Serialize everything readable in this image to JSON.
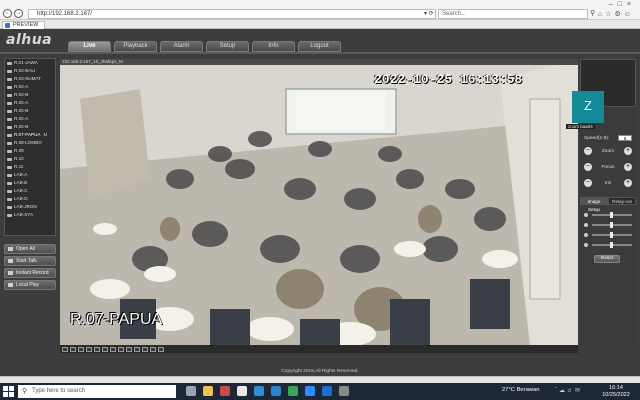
{
  "browser": {
    "url": "http://192.168.2.167/",
    "search_placeholder": "Search...",
    "tab_title": "PREVIEW"
  },
  "app": {
    "logo": "alhua",
    "nav_tabs": [
      {
        "label": "Live",
        "active": true
      },
      {
        "label": "Playback",
        "active": false
      },
      {
        "label": "Alarm",
        "active": false
      },
      {
        "label": "Setup",
        "active": false
      },
      {
        "label": "Info",
        "active": false
      },
      {
        "label": "Logout",
        "active": false
      }
    ],
    "channels": [
      "R.01-JAWA",
      "R.02-BALI",
      "R.03-SUMAT",
      "R.04-A",
      "R.04-B",
      "R.05-A",
      "R.05-B",
      "R.06-A",
      "R.06-B",
      "R.07-PAPUA",
      "R.08-LOMBO",
      "R.09",
      "R.10",
      "R.11",
      "LAB-A",
      "LAB-B",
      "LAB-C",
      "LAB-D",
      "LAB-JRGN",
      "LAB-SYA"
    ],
    "selected_channel_mark": "M",
    "side_buttons": [
      "Open All",
      "Start Talk",
      "Instant Record",
      "Local Play"
    ],
    "video": {
      "info_bar": "192.168.2.167_10_4kMbps_M",
      "timestamp": "2022-10-25 16:13:58",
      "camera_label": "R.07-PAPUA"
    },
    "ptz": {
      "speed_label": "Speed(1-8):",
      "speed_value": "5",
      "zoom_label": "Zoom",
      "focus_label": "Focus",
      "iris_label": "Iris"
    },
    "zoom_overlay": {
      "initial": "Z",
      "caption": "zoom baa04"
    },
    "image_tabs": [
      "Image Setup",
      "Relay-out"
    ],
    "reset_label": "Reset",
    "footer": "Copyright 2015,All Rights Reserved."
  },
  "taskbar": {
    "search_placeholder": "Type here to search",
    "weather": "27°C  Berawan",
    "time": "16:14",
    "date": "10/25/2022"
  }
}
